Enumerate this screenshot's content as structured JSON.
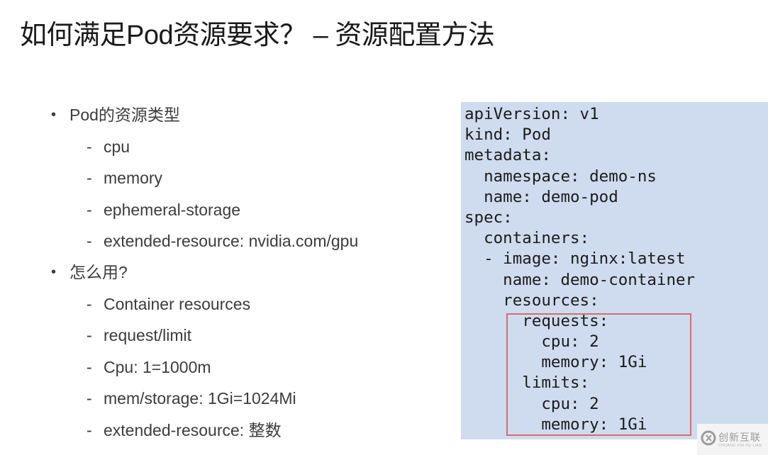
{
  "slide": {
    "title": "如何满足Pod资源要求？ – 资源配置方法",
    "bullets": [
      {
        "label": "Pod的资源类型",
        "items": [
          "cpu",
          "memory",
          "ephemeral-storage",
          "extended-resource: nvidia.com/gpu"
        ]
      },
      {
        "label": "怎么用?",
        "items": [
          "Container resources",
          "request/limit",
          "Cpu: 1=1000m",
          "mem/storage: 1Gi=1024Mi",
          "extended-resource: 整数"
        ]
      }
    ],
    "bullet_symbol": "•",
    "dash_symbol": "-"
  },
  "code": {
    "lines": [
      "apiVersion: v1",
      "kind: Pod",
      "metadata:",
      "  namespace: demo-ns",
      "  name: demo-pod",
      "spec:",
      "  containers:",
      "  - image: nginx:latest",
      "    name: demo-container",
      "    resources:",
      "      requests:",
      "        cpu: 2",
      "        memory: 1Gi",
      "      limits:",
      "        cpu: 2",
      "        memory: 1Gi"
    ],
    "background_color": "#cfdcef",
    "highlight_color": "#d06e6e"
  },
  "watermark": {
    "text": "创新互联",
    "subtext": "CHUANG XIN HU LIAN"
  }
}
